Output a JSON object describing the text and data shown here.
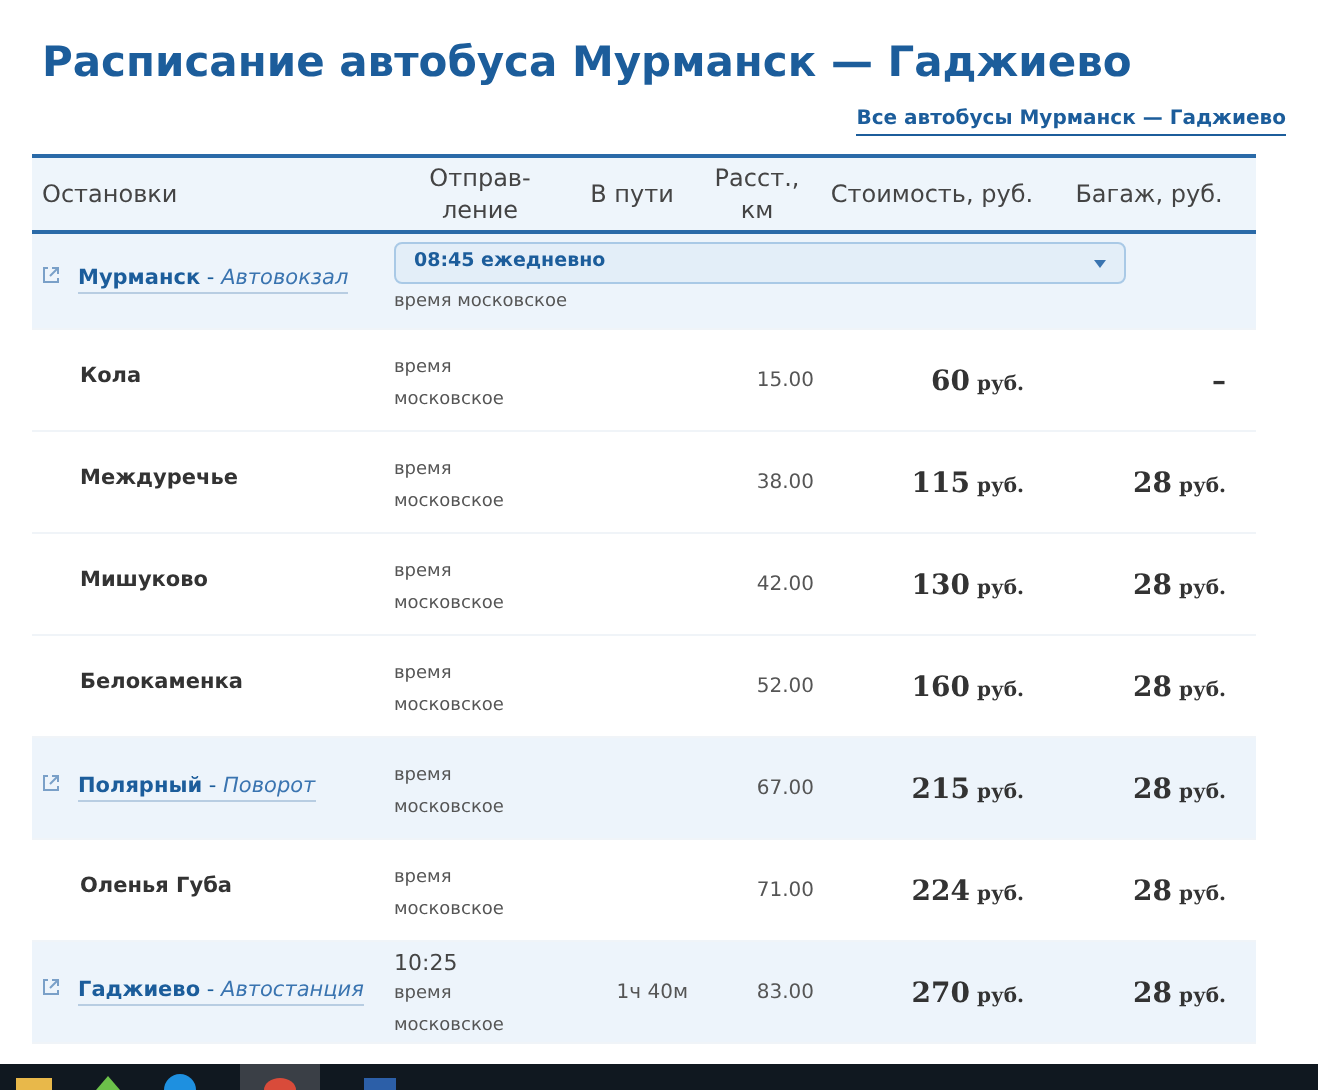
{
  "title": "Расписание автобуса Мурманск — Гаджиево",
  "all_buses_link": "Все автобусы Мурманск — Гаджиево",
  "columns": [
    "Остановки",
    "Отправ-\nление",
    "В пути",
    "Расст.,\nкм",
    "Стоимость, руб.",
    "Багаж, руб."
  ],
  "rows": [
    {
      "kind": "major",
      "stop": "**Мурманск** - *Автовокзал*",
      "departure_select": "08:45 ежедневно",
      "time_note": "время московское"
    },
    {
      "kind": "minor",
      "stop": "Кола",
      "time_note": "время\nмосковское",
      "distance": "15.00",
      "price": {
        "amount": "60",
        "unit": "руб."
      },
      "baggage": {
        "amount": "–"
      }
    },
    {
      "kind": "minor",
      "stop": "Междуречье",
      "time_note": "время\nмосковское",
      "distance": "38.00",
      "price": {
        "amount": "115",
        "unit": "руб."
      },
      "baggage": {
        "amount": "28",
        "unit": "руб."
      }
    },
    {
      "kind": "minor",
      "stop": "Мишуково",
      "time_note": "время\nмосковское",
      "distance": "42.00",
      "price": {
        "amount": "130",
        "unit": "руб."
      },
      "baggage": {
        "amount": "28",
        "unit": "руб."
      }
    },
    {
      "kind": "minor",
      "stop": "Белокаменка",
      "time_note": "время\nмосковское",
      "distance": "52.00",
      "price": {
        "amount": "160",
        "unit": "руб."
      },
      "baggage": {
        "amount": "28",
        "unit": "руб."
      }
    },
    {
      "kind": "major",
      "stop": "**Полярный** - *Поворот*",
      "time_note": "время\nмосковское",
      "distance": "67.00",
      "price": {
        "amount": "215",
        "unit": "руб."
      },
      "baggage": {
        "amount": "28",
        "unit": "руб."
      }
    },
    {
      "kind": "minor",
      "stop": "Оленья Губа",
      "time_note": "время\nмосковское",
      "distance": "71.00",
      "price": {
        "amount": "224",
        "unit": "руб."
      },
      "baggage": {
        "amount": "28",
        "unit": "руб."
      }
    },
    {
      "kind": "major",
      "stop": "**Гаджиево** - *Автостанция*",
      "arrival": "10:25",
      "time_note": "время\nмосковское",
      "travel_time": "1ч 40м",
      "distance": "83.00",
      "price": {
        "amount": "270",
        "unit": "руб."
      },
      "baggage": {
        "amount": "28",
        "unit": "руб."
      }
    }
  ]
}
